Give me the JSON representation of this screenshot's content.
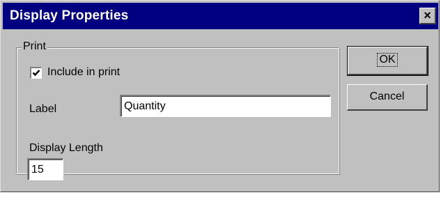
{
  "window": {
    "title": "Display Properties",
    "close_glyph": "×"
  },
  "group": {
    "label": "Print"
  },
  "include_in_print": {
    "label": "Include in print",
    "checked": true
  },
  "label_field": {
    "label": "Label",
    "value": "Quantity"
  },
  "display_length": {
    "label": "Display Length",
    "value": "15"
  },
  "buttons": {
    "ok": "OK",
    "cancel": "Cancel"
  },
  "colors": {
    "titlebar": "#000080",
    "face": "#c0c0c0"
  }
}
